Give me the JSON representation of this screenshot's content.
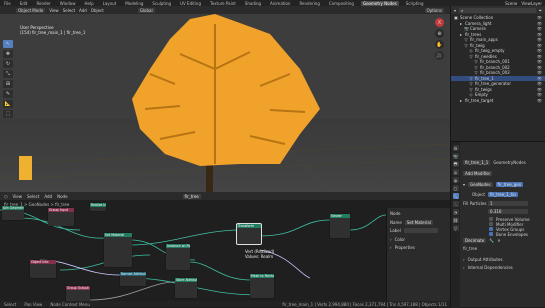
{
  "workspaces": [
    "File",
    "Edit",
    "Render",
    "Window",
    "Help",
    "Layout",
    "Modeling",
    "Sculpting",
    "UV Editing",
    "Texture Paint",
    "Shading",
    "Animation",
    "Rendering",
    "Compositing",
    "Geometry Nodes",
    "Scripting"
  ],
  "active_workspace": "Geometry Nodes",
  "window_title": "Scene",
  "view_layer": "ViewLayer",
  "viewport": {
    "mode": "Object Mode",
    "menus": [
      "View",
      "Select",
      "Add",
      "Object"
    ],
    "orientation": "Global",
    "info_line1": "User Perspective",
    "info_line2": "(154) fir_tree_main_1 | fir_tree_1",
    "options_label": "Options"
  },
  "toolbar_icons": [
    "cursor-icon",
    "move-icon",
    "rotate-icon",
    "scale-icon",
    "transform-icon",
    "annotate-icon",
    "measure-icon",
    "add-cube-icon"
  ],
  "outliner": {
    "title": "Scene Collection",
    "items": [
      {
        "label": "Scene Collection",
        "depth": 0,
        "icon": "▣"
      },
      {
        "label": "Camera_light",
        "depth": 1,
        "icon": "▸"
      },
      {
        "label": "Camera",
        "depth": 2,
        "icon": "📷"
      },
      {
        "label": "fir_trees",
        "depth": 1,
        "icon": "▸"
      },
      {
        "label": "fir_main_apps",
        "depth": 2,
        "icon": "▽"
      },
      {
        "label": "fir_twig",
        "depth": 2,
        "icon": "▽"
      },
      {
        "label": "fir_twig_empty",
        "depth": 3,
        "icon": "◇"
      },
      {
        "label": "fir_needles",
        "depth": 3,
        "icon": "▽"
      },
      {
        "label": "fir_branch_001",
        "depth": 4,
        "icon": "▽"
      },
      {
        "label": "fir_branch_002",
        "depth": 4,
        "icon": "▽"
      },
      {
        "label": "fir_branch_003",
        "depth": 4,
        "icon": "▽"
      },
      {
        "label": "fir_tree_1",
        "depth": 3,
        "icon": "▽"
      },
      {
        "label": "fir_tree_generator",
        "depth": 3,
        "icon": "▽"
      },
      {
        "label": "fir_twigs",
        "depth": 3,
        "icon": "▽"
      },
      {
        "label": "Empty",
        "depth": 3,
        "icon": "◇"
      },
      {
        "label": "fir_tree_target",
        "depth": 1,
        "icon": "▸"
      }
    ],
    "selected_index": 11
  },
  "properties": {
    "object_name": "fir_tree_1_1",
    "modifier_panel": "GeometryNodes",
    "add_modifier": "Add Modifier",
    "modifier_name": "GeoNodes",
    "node_group": "fir_tree_gen",
    "fields": [
      {
        "label": "Object",
        "value": "fir_tree_1_tin"
      },
      {
        "label": "Fill Particles",
        "value": "1"
      },
      {
        "label": "",
        "value": "0.310"
      }
    ],
    "checks": [
      {
        "label": "Preserve Volume",
        "on": false
      },
      {
        "label": "Multi Modifier",
        "on": false
      },
      {
        "label": "Vertex Groups",
        "on": true
      },
      {
        "label": "Bone Envelopes",
        "on": true
      }
    ],
    "bind_to_label": "Bind To",
    "sub_modifier": "Decimate",
    "sub_value": "fir_tree",
    "sections": [
      "Output Attributes",
      "Internal Dependencies"
    ]
  },
  "node_editor": {
    "menus": [
      "View",
      "Select",
      "Add",
      "Node"
    ],
    "node_group": "fir_tree",
    "breadcrumb": "fir_tree_1 > GeoNodes > fir_tree",
    "nodes": [
      {
        "title": "Join Geometry",
        "kind": "geo"
      },
      {
        "title": "Group Input",
        "kind": "inp"
      },
      {
        "title": "Realize Instances",
        "kind": "geo"
      },
      {
        "title": "Set Material",
        "kind": "geo"
      },
      {
        "title": "Instance on Points",
        "kind": "geo"
      },
      {
        "title": "Transform",
        "kind": "geo"
      },
      {
        "title": "Object Info",
        "kind": "inp"
      },
      {
        "title": "Named Attribute",
        "kind": "attr"
      },
      {
        "title": "Store Attribute",
        "kind": "geo"
      },
      {
        "title": "Mesh to Points",
        "kind": "geo"
      },
      {
        "title": "Group Output",
        "kind": "inp"
      },
      {
        "title": "Viewer",
        "kind": "geo"
      }
    ],
    "tooltip_lines": [
      "Vert (Realized)",
      "Values: Realm"
    ],
    "sidebar": {
      "title": "Node",
      "name_label": "Name",
      "name_value": "Set Material",
      "label_label": "Label",
      "color_label": "Color",
      "properties_label": "Properties"
    }
  },
  "statusbar": [
    "Select",
    "Pan View",
    "Node Context Menu"
  ],
  "status_right": "fir_tree_main_1 | Verts 2,994,880 | Faces 2,371,794 | Tris 4,597,188 | Objects 1/11"
}
